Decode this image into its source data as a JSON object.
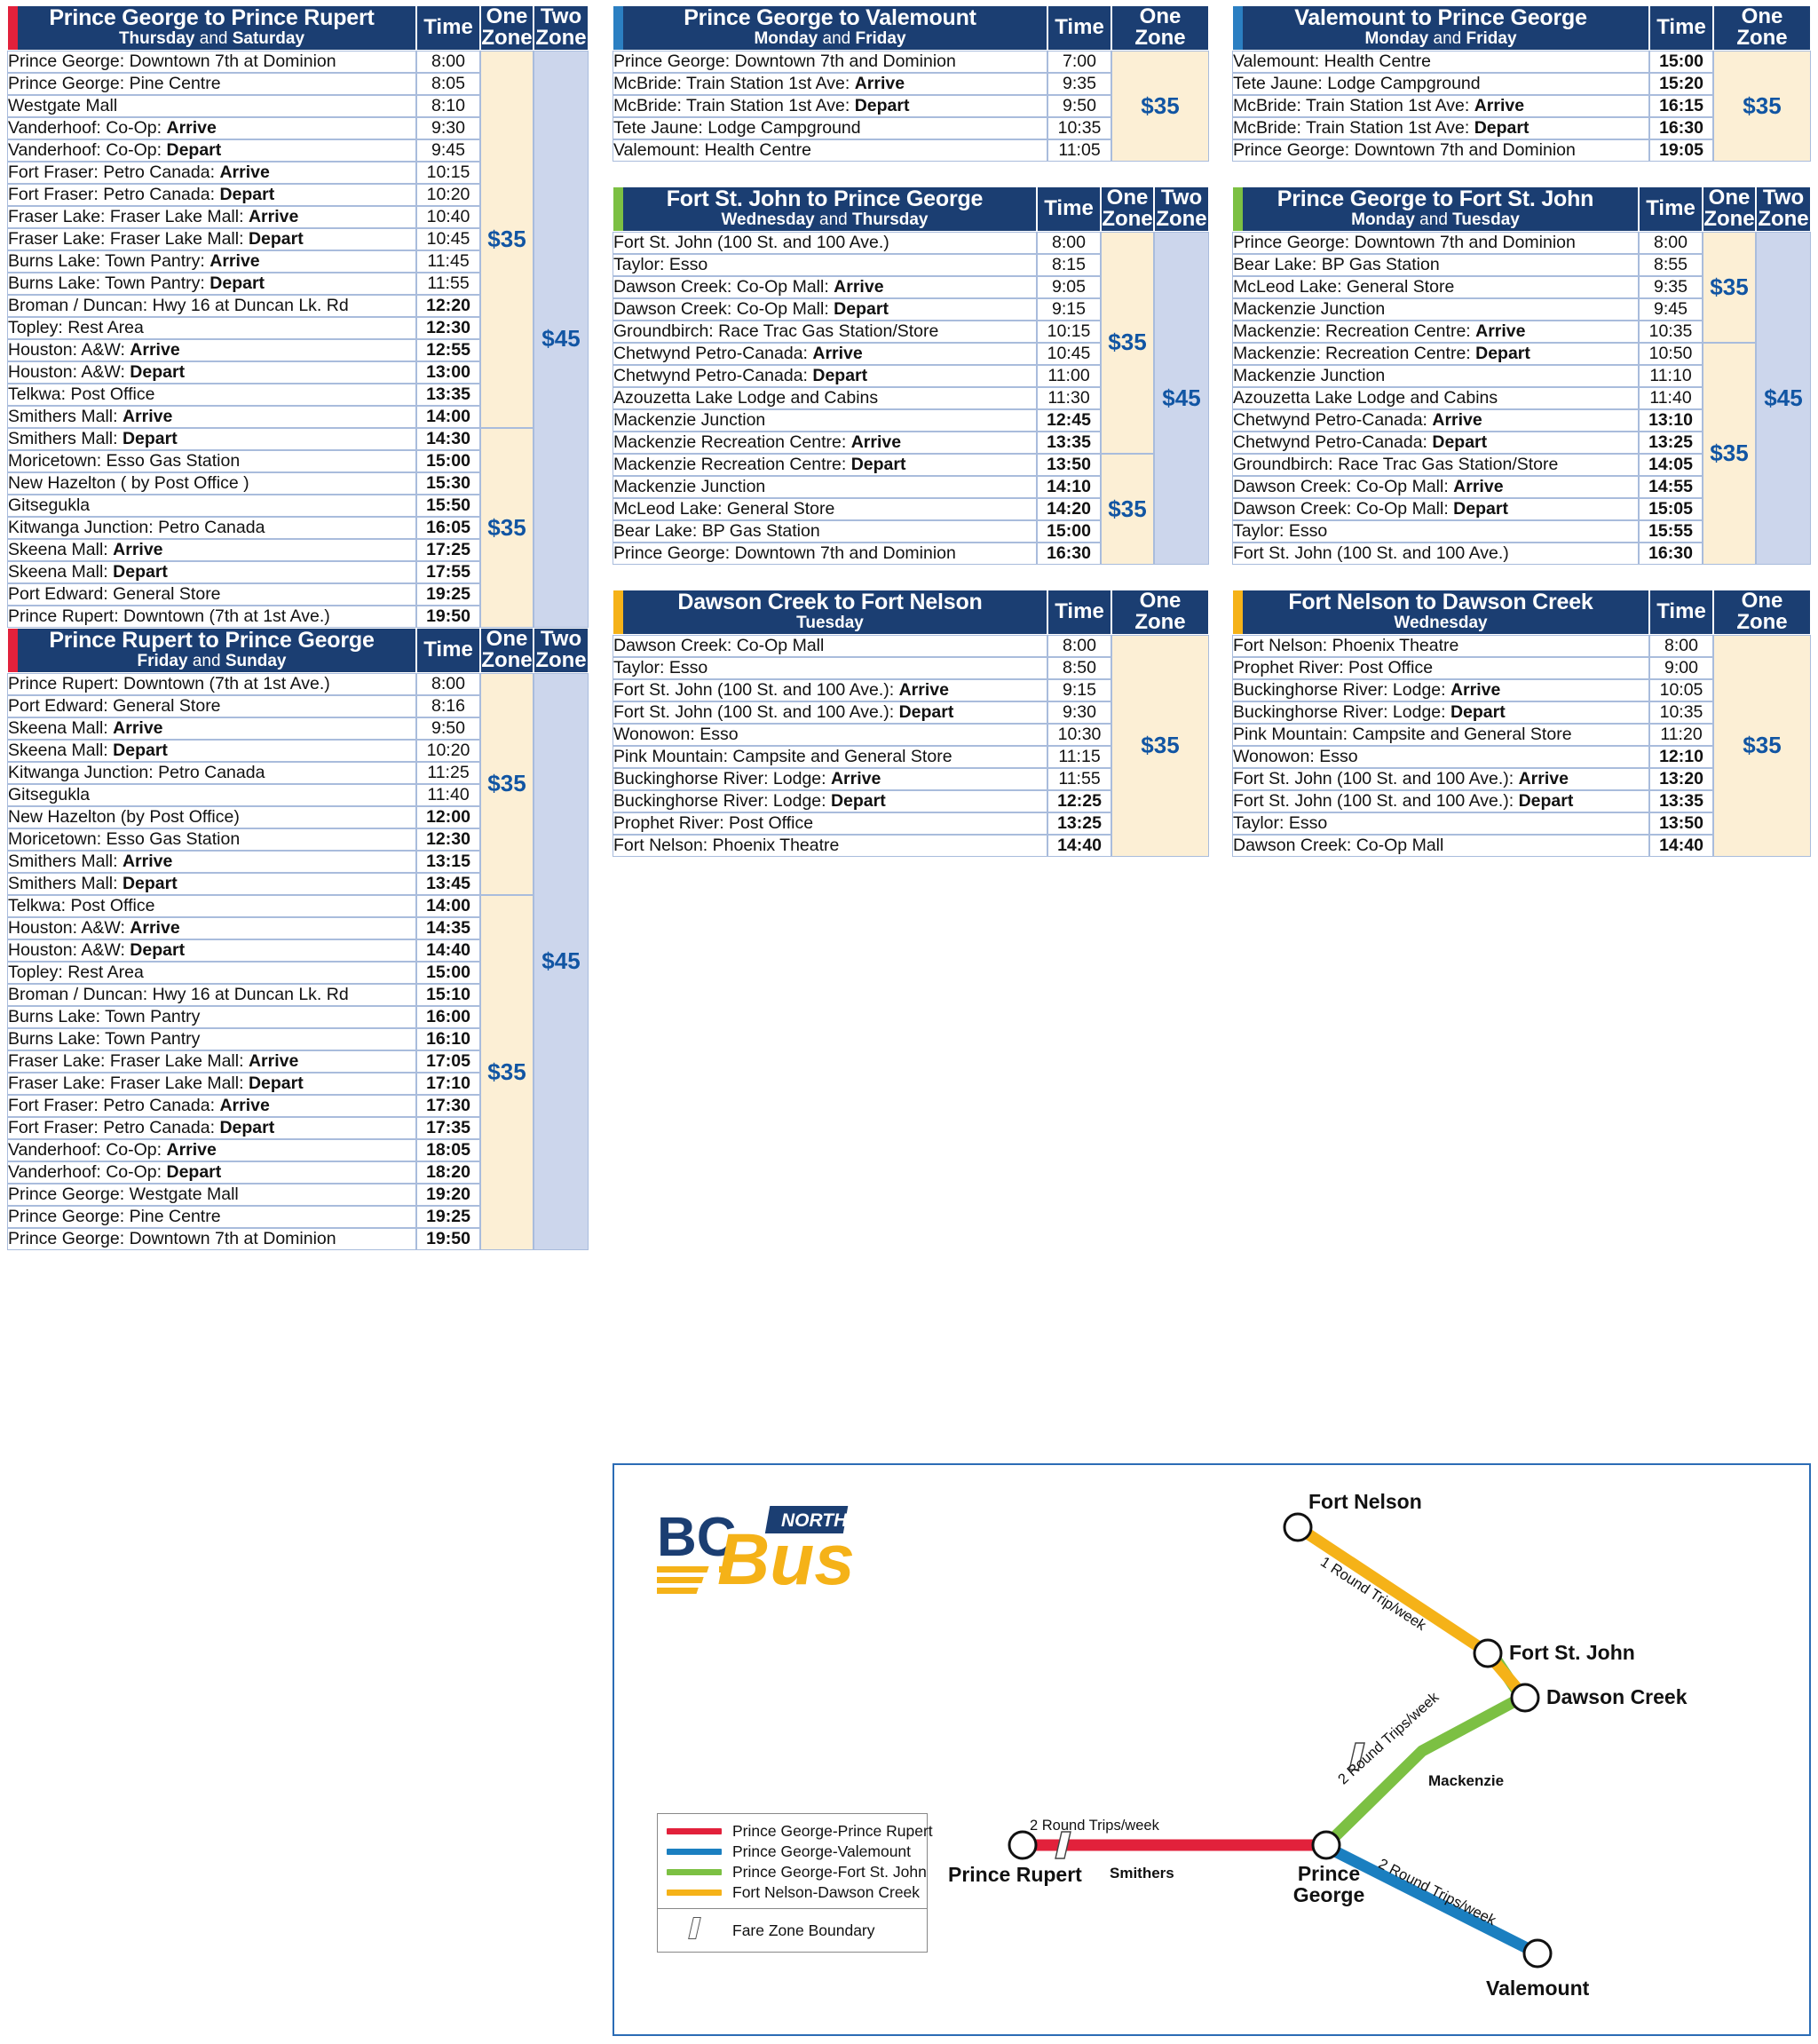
{
  "columns": {
    "time_label": "Time",
    "one_zone_label": "One Zone",
    "one_zone_label_stacked": "One<br>Zone",
    "two_zone_label_stacked": "Two<br>Zone"
  },
  "tables": [
    {
      "id": "pg-to-pr",
      "title": "Prince George to Prince Rupert",
      "days_html": "<b>Thursday</b> and <b>Saturday</b>",
      "accent_color": "#e2213b",
      "zone_headers": [
        "Time",
        "One Zone",
        "Two Zone"
      ],
      "zone_stacked": true,
      "rows": [
        {
          "stop": "Prince George: Downtown 7th at Dominion",
          "time": "8:00",
          "bold": false
        },
        {
          "stop": "Prince George: Pine Centre",
          "time": "8:05",
          "bold": false
        },
        {
          "stop": "Westgate Mall",
          "time": "8:10",
          "bold": false
        },
        {
          "stop": "Vanderhoof: Co-Op: <b>Arrive</b>",
          "time": "9:30",
          "bold": false
        },
        {
          "stop": "Vanderhoof: Co-Op: <b>Depart</b>",
          "time": "9:45",
          "bold": false
        },
        {
          "stop": "Fort Fraser: Petro Canada: <b>Arrive</b>",
          "time": "10:15",
          "bold": false
        },
        {
          "stop": "Fort Fraser: Petro Canada: <b>Depart</b>",
          "time": "10:20",
          "bold": false
        },
        {
          "stop": "Fraser Lake: Fraser Lake Mall: <b>Arrive</b>",
          "time": "10:40",
          "bold": false
        },
        {
          "stop": "Fraser Lake: Fraser Lake Mall: <b>Depart</b>",
          "time": "10:45",
          "bold": false
        },
        {
          "stop": "Burns Lake: Town Pantry: <b>Arrive</b>",
          "time": "11:45",
          "bold": false
        },
        {
          "stop": "Burns Lake: Town Pantry: <b>Depart</b>",
          "time": "11:55",
          "bold": false
        },
        {
          "stop": "Broman / Duncan: Hwy 16 at Duncan Lk. Rd",
          "time": "12:20",
          "bold": true
        },
        {
          "stop": "Topley: Rest Area",
          "time": "12:30",
          "bold": true
        },
        {
          "stop": "Houston: A&amp;W: <b>Arrive</b>",
          "time": "12:55",
          "bold": true
        },
        {
          "stop": "Houston: A&amp;W: <b>Depart</b>",
          "time": "13:00",
          "bold": true
        },
        {
          "stop": "Telkwa: Post Office",
          "time": "13:35",
          "bold": true
        },
        {
          "stop": "Smithers Mall: <b>Arrive</b>",
          "time": "14:00",
          "bold": true
        },
        {
          "stop": "Smithers Mall: <b>Depart</b>",
          "time": "14:30",
          "bold": true
        },
        {
          "stop": "Moricetown: Esso Gas Station",
          "time": "15:00",
          "bold": true
        },
        {
          "stop": "New Hazelton ( by Post Office )",
          "time": "15:30",
          "bold": true
        },
        {
          "stop": "Gitsegukla",
          "time": "15:50",
          "bold": true
        },
        {
          "stop": "Kitwanga Junction: Petro Canada",
          "time": "16:05",
          "bold": true
        },
        {
          "stop": "Skeena Mall: <b>Arrive</b>",
          "time": "17:25",
          "bold": true
        },
        {
          "stop": "Skeena Mall: <b>Depart</b>",
          "time": "17:55",
          "bold": true
        },
        {
          "stop": "Port Edward: General Store",
          "time": "19:25",
          "bold": true
        },
        {
          "stop": "Prince Rupert: Downtown (7th at 1st Ave.)",
          "time": "19:50",
          "bold": true
        }
      ],
      "zone1_blocks": [
        {
          "start": 0,
          "span": 17,
          "fare": "$35"
        },
        {
          "start": 17,
          "span": 9,
          "fare": "$35"
        }
      ],
      "zone2_blocks": [
        {
          "start": 0,
          "span": 26,
          "fare": "$45"
        }
      ]
    },
    {
      "id": "pr-to-pg",
      "title": "Prince Rupert to Prince George",
      "days_html": "<b>Friday</b> and <b>Sunday</b>",
      "accent_color": "#e2213b",
      "zone_headers": [
        "Time",
        "One Zone",
        "Two Zone"
      ],
      "zone_stacked": true,
      "rows": [
        {
          "stop": "Prince Rupert: Downtown (7th at 1st Ave.)",
          "time": "8:00",
          "bold": false
        },
        {
          "stop": "Port Edward: General Store",
          "time": "8:16",
          "bold": false
        },
        {
          "stop": "Skeena Mall: <b>Arrive</b>",
          "time": "9:50",
          "bold": false
        },
        {
          "stop": "Skeena Mall: <b>Depart</b>",
          "time": "10:20",
          "bold": false
        },
        {
          "stop": "Kitwanga Junction: Petro Canada",
          "time": "11:25",
          "bold": false
        },
        {
          "stop": "Gitsegukla",
          "time": "11:40",
          "bold": false
        },
        {
          "stop": "New Hazelton (by Post Office)",
          "time": "12:00",
          "bold": true
        },
        {
          "stop": "Moricetown: Esso Gas Station",
          "time": "12:30",
          "bold": true
        },
        {
          "stop": "Smithers Mall: <b>Arrive</b>",
          "time": "13:15",
          "bold": true
        },
        {
          "stop": "Smithers Mall: <b>Depart</b>",
          "time": "13:45",
          "bold": true
        },
        {
          "stop": "Telkwa: Post Office",
          "time": "14:00",
          "bold": true
        },
        {
          "stop": "Houston: A&amp;W: <b>Arrive</b>",
          "time": "14:35",
          "bold": true
        },
        {
          "stop": "Houston: A&amp;W: <b>Depart</b>",
          "time": "14:40",
          "bold": true
        },
        {
          "stop": "Topley: Rest Area",
          "time": "15:00",
          "bold": true
        },
        {
          "stop": "Broman / Duncan: Hwy 16 at Duncan Lk. Rd",
          "time": "15:10",
          "bold": true
        },
        {
          "stop": "Burns Lake: Town Pantry",
          "time": "16:00",
          "bold": true
        },
        {
          "stop": "Burns Lake: Town Pantry",
          "time": "16:10",
          "bold": true
        },
        {
          "stop": "Fraser Lake: Fraser Lake Mall: <b>Arrive</b>",
          "time": "17:05",
          "bold": true
        },
        {
          "stop": "Fraser Lake: Fraser Lake Mall: <b>Depart</b>",
          "time": "17:10",
          "bold": true
        },
        {
          "stop": "Fort Fraser: Petro Canada: <b>Arrive</b>",
          "time": "17:30",
          "bold": true
        },
        {
          "stop": "Fort Fraser: Petro Canada: <b>Depart</b>",
          "time": "17:35",
          "bold": true
        },
        {
          "stop": "Vanderhoof: Co-Op: <b>Arrive</b>",
          "time": "18:05",
          "bold": true
        },
        {
          "stop": "Vanderhoof: Co-Op: <b>Depart</b>",
          "time": "18:20",
          "bold": true
        },
        {
          "stop": "Prince George: Westgate Mall",
          "time": "19:20",
          "bold": true
        },
        {
          "stop": "Prince George: Pine Centre",
          "time": "19:25",
          "bold": true
        },
        {
          "stop": "Prince George: Downtown 7th at Dominion",
          "time": "19:50",
          "bold": true
        }
      ],
      "zone1_blocks": [
        {
          "start": 0,
          "span": 10,
          "fare": "$35"
        },
        {
          "start": 10,
          "span": 16,
          "fare": "$35"
        }
      ],
      "zone2_blocks": [
        {
          "start": 0,
          "span": 26,
          "fare": "$45"
        }
      ]
    },
    {
      "id": "pg-to-valemount",
      "title": "Prince George to Valemount",
      "days_html": "<b>Monday</b> and <b>Friday</b>",
      "accent_color": "#2b7fc2",
      "zone_headers": [
        "Time",
        "One Zone"
      ],
      "zone_stacked": false,
      "rows": [
        {
          "stop": "Prince George: Downtown 7th and Dominion",
          "time": "7:00",
          "bold": false
        },
        {
          "stop": "McBride: Train Station 1st Ave: <b>Arrive</b>",
          "time": "9:35",
          "bold": false
        },
        {
          "stop": "McBride: Train Station 1st Ave: <b>Depart</b>",
          "time": "9:50",
          "bold": false
        },
        {
          "stop": "Tete Jaune: Lodge Campground",
          "time": "10:35",
          "bold": false
        },
        {
          "stop": "Valemount: Health Centre",
          "time": "11:05",
          "bold": false
        }
      ],
      "zone1_blocks": [
        {
          "start": 0,
          "span": 5,
          "fare": "$35"
        }
      ],
      "zone2_blocks": []
    },
    {
      "id": "valemount-to-pg",
      "title": "Valemount to Prince George",
      "days_html": "<b>Monday</b> and <b>Friday</b>",
      "accent_color": "#2b7fc2",
      "zone_headers": [
        "Time",
        "One Zone"
      ],
      "zone_stacked": false,
      "rows": [
        {
          "stop": "Valemount: Health Centre",
          "time": "15:00",
          "bold": true
        },
        {
          "stop": "Tete Jaune: Lodge Campground",
          "time": "15:20",
          "bold": true
        },
        {
          "stop": "McBride: Train Station 1st Ave: <b>Arrive</b>",
          "time": "16:15",
          "bold": true
        },
        {
          "stop": "McBride: Train Station 1st Ave: <b>Depart</b>",
          "time": "16:30",
          "bold": true
        },
        {
          "stop": "Prince George: Downtown 7th and Dominion",
          "time": "19:05",
          "bold": true
        }
      ],
      "zone1_blocks": [
        {
          "start": 0,
          "span": 5,
          "fare": "$35"
        }
      ],
      "zone2_blocks": []
    },
    {
      "id": "fsj-to-pg",
      "title": "Fort St. John to Prince George",
      "days_html": "<b>Wednesday</b> and <b>Thursday</b>",
      "accent_color": "#7cc043",
      "zone_headers": [
        "Time",
        "One Zone",
        "Two Zone"
      ],
      "zone_stacked": true,
      "rows": [
        {
          "stop": "Fort St. John (100 St. and 100 Ave.)",
          "time": "8:00",
          "bold": false
        },
        {
          "stop": "Taylor: Esso",
          "time": "8:15",
          "bold": false
        },
        {
          "stop": "Dawson Creek: Co-Op Mall: <b>Arrive</b>",
          "time": "9:05",
          "bold": false
        },
        {
          "stop": "Dawson Creek: Co-Op Mall: <b>Depart</b>",
          "time": "9:15",
          "bold": false
        },
        {
          "stop": "Groundbirch: Race Trac Gas Station/Store",
          "time": "10:15",
          "bold": false
        },
        {
          "stop": "Chetwynd Petro-Canada: <b>Arrive</b>",
          "time": "10:45",
          "bold": false
        },
        {
          "stop": "Chetwynd Petro-Canada: <b>Depart</b>",
          "time": "11:00",
          "bold": false
        },
        {
          "stop": "Azouzetta Lake Lodge and Cabins",
          "time": "11:30",
          "bold": false
        },
        {
          "stop": "Mackenzie Junction",
          "time": "12:45",
          "bold": true
        },
        {
          "stop": "Mackenzie Recreation Centre: <b>Arrive</b>",
          "time": "13:35",
          "bold": true
        },
        {
          "stop": "Mackenzie Recreation Centre: <b>Depart</b>",
          "time": "13:50",
          "bold": true
        },
        {
          "stop": "Mackenzie Junction",
          "time": "14:10",
          "bold": true
        },
        {
          "stop": "McLeod Lake: General Store",
          "time": "14:20",
          "bold": true
        },
        {
          "stop": "Bear Lake: BP Gas Station",
          "time": "15:00",
          "bold": true
        },
        {
          "stop": "Prince George: Downtown 7th and Dominion",
          "time": "16:30",
          "bold": true
        }
      ],
      "zone1_blocks": [
        {
          "start": 0,
          "span": 10,
          "fare": "$35"
        },
        {
          "start": 10,
          "span": 5,
          "fare": "$35"
        }
      ],
      "zone2_blocks": [
        {
          "start": 0,
          "span": 15,
          "fare": "$45"
        }
      ]
    },
    {
      "id": "pg-to-fsj",
      "title": "Prince George to Fort St. John",
      "days_html": "<b>Monday</b> and <b>Tuesday</b>",
      "accent_color": "#7cc043",
      "zone_headers": [
        "Time",
        "One Zone",
        "Two Zone"
      ],
      "zone_stacked": true,
      "rows": [
        {
          "stop": "Prince George: Downtown 7th and Dominion",
          "time": "8:00",
          "bold": false
        },
        {
          "stop": "Bear Lake: BP Gas Station",
          "time": "8:55",
          "bold": false
        },
        {
          "stop": "McLeod Lake: General Store",
          "time": "9:35",
          "bold": false
        },
        {
          "stop": "Mackenzie Junction",
          "time": "9:45",
          "bold": false
        },
        {
          "stop": "Mackenzie: Recreation Centre: <b>Arrive</b>",
          "time": "10:35",
          "bold": false
        },
        {
          "stop": "Mackenzie: Recreation Centre: <b>Depart</b>",
          "time": "10:50",
          "bold": false
        },
        {
          "stop": "Mackenzie Junction",
          "time": "11:10",
          "bold": false
        },
        {
          "stop": "Azouzetta Lake Lodge and Cabins",
          "time": "11:40",
          "bold": false
        },
        {
          "stop": "Chetwynd Petro-Canada: <b>Arrive</b>",
          "time": "13:10",
          "bold": true
        },
        {
          "stop": "Chetwynd Petro-Canada: <b>Depart</b>",
          "time": "13:25",
          "bold": true
        },
        {
          "stop": "Groundbirch: Race Trac Gas Station/Store",
          "time": "14:05",
          "bold": true
        },
        {
          "stop": "Dawson Creek: Co-Op Mall: <b>Arrive</b>",
          "time": "14:55",
          "bold": true
        },
        {
          "stop": "Dawson Creek: Co-Op Mall: <b>Depart</b>",
          "time": "15:05",
          "bold": true
        },
        {
          "stop": "Taylor: Esso",
          "time": "15:55",
          "bold": true
        },
        {
          "stop": "Fort St. John (100 St. and 100 Ave.)",
          "time": "16:30",
          "bold": true
        }
      ],
      "zone1_blocks": [
        {
          "start": 0,
          "span": 5,
          "fare": "$35"
        },
        {
          "start": 5,
          "span": 10,
          "fare": "$35"
        }
      ],
      "zone2_blocks": [
        {
          "start": 0,
          "span": 15,
          "fare": "$45"
        }
      ]
    },
    {
      "id": "dc-to-fn",
      "title": "Dawson Creek to Fort Nelson",
      "days_html": "<b>Tuesday</b>",
      "accent_color": "#f5b218",
      "zone_headers": [
        "Time",
        "One Zone"
      ],
      "zone_stacked": false,
      "rows": [
        {
          "stop": "Dawson Creek: Co-Op Mall",
          "time": "8:00",
          "bold": false
        },
        {
          "stop": "Taylor: Esso",
          "time": "8:50",
          "bold": false
        },
        {
          "stop": "Fort St. John (100 St. and 100 Ave.): <b>Arrive</b>",
          "time": "9:15",
          "bold": false
        },
        {
          "stop": "Fort St. John (100 St. and 100 Ave.): <b>Depart</b>",
          "time": "9:30",
          "bold": false
        },
        {
          "stop": "Wonowon: Esso",
          "time": "10:30",
          "bold": false
        },
        {
          "stop": "Pink Mountain: Campsite and General Store",
          "time": "11:15",
          "bold": false
        },
        {
          "stop": "Buckinghorse River: Lodge: <b>Arrive</b>",
          "time": "11:55",
          "bold": false
        },
        {
          "stop": "Buckinghorse River: Lodge: <b>Depart</b>",
          "time": "12:25",
          "bold": true
        },
        {
          "stop": "Prophet River: Post Office",
          "time": "13:25",
          "bold": true
        },
        {
          "stop": "Fort Nelson: Phoenix Theatre",
          "time": "14:40",
          "bold": true
        }
      ],
      "zone1_blocks": [
        {
          "start": 0,
          "span": 10,
          "fare": "$35"
        }
      ],
      "zone2_blocks": []
    },
    {
      "id": "fn-to-dc",
      "title": "Fort Nelson to Dawson Creek",
      "days_html": "<b>Wednesday</b>",
      "accent_color": "#f5b218",
      "zone_headers": [
        "Time",
        "One Zone"
      ],
      "zone_stacked": false,
      "rows": [
        {
          "stop": "Fort Nelson: Phoenix Theatre",
          "time": "8:00",
          "bold": false
        },
        {
          "stop": "Prophet River: Post Office",
          "time": "9:00",
          "bold": false
        },
        {
          "stop": "Buckinghorse River: Lodge: <b>Arrive</b>",
          "time": "10:05",
          "bold": false
        },
        {
          "stop": "Buckinghorse River: Lodge: <b>Depart</b>",
          "time": "10:35",
          "bold": false
        },
        {
          "stop": "Pink Mountain: Campsite and General Store",
          "time": "11:20",
          "bold": false
        },
        {
          "stop": "Wonowon: Esso",
          "time": "12:10",
          "bold": true
        },
        {
          "stop": "Fort St. John (100 St. and 100 Ave.): <b>Arrive</b>",
          "time": "13:20",
          "bold": true
        },
        {
          "stop": "Fort St. John (100 St. and 100 Ave.): <b>Depart</b>",
          "time": "13:35",
          "bold": true
        },
        {
          "stop": "Taylor: Esso",
          "time": "13:50",
          "bold": true
        },
        {
          "stop": "Dawson Creek: Co-Op Mall",
          "time": "14:40",
          "bold": true
        }
      ],
      "zone1_blocks": [
        {
          "start": 0,
          "span": 10,
          "fare": "$35"
        }
      ],
      "zone2_blocks": []
    }
  ],
  "map": {
    "logo": {
      "bc": "BC",
      "bus": "Bus",
      "north": "NORTH"
    },
    "legend": {
      "routes": [
        {
          "label": "Prince George-Prince Rupert",
          "color": "#e2213b"
        },
        {
          "label": "Prince George-Valemount",
          "color": "#1b7fc0"
        },
        {
          "label": "Prince George-Fort St. John",
          "color": "#7cc043"
        },
        {
          "label": "Fort Nelson-Dawson Creek",
          "color": "#f5b218"
        }
      ],
      "fare_zone_boundary": "Fare Zone Boundary"
    },
    "nodes": [
      {
        "name": "Fort Nelson",
        "label": "Fort Nelson"
      },
      {
        "name": "Fort St. John",
        "label": "Fort St. John"
      },
      {
        "name": "Dawson Creek",
        "label": "Dawson Creek"
      },
      {
        "name": "Prince George",
        "label": "Prince George"
      },
      {
        "name": "Prince Rupert",
        "label": "Prince Rupert"
      },
      {
        "name": "Valemount",
        "label": "Valemount"
      }
    ],
    "minor_labels": [
      "Smithers",
      "Mackenzie"
    ],
    "trip_labels": {
      "fn_fsj": "1 Round Trip/week",
      "dc_pg": "2 Round Trips/week",
      "pr_pg": "2 Round Trips/week",
      "pg_valemount": "2 Round Trips/week"
    }
  }
}
